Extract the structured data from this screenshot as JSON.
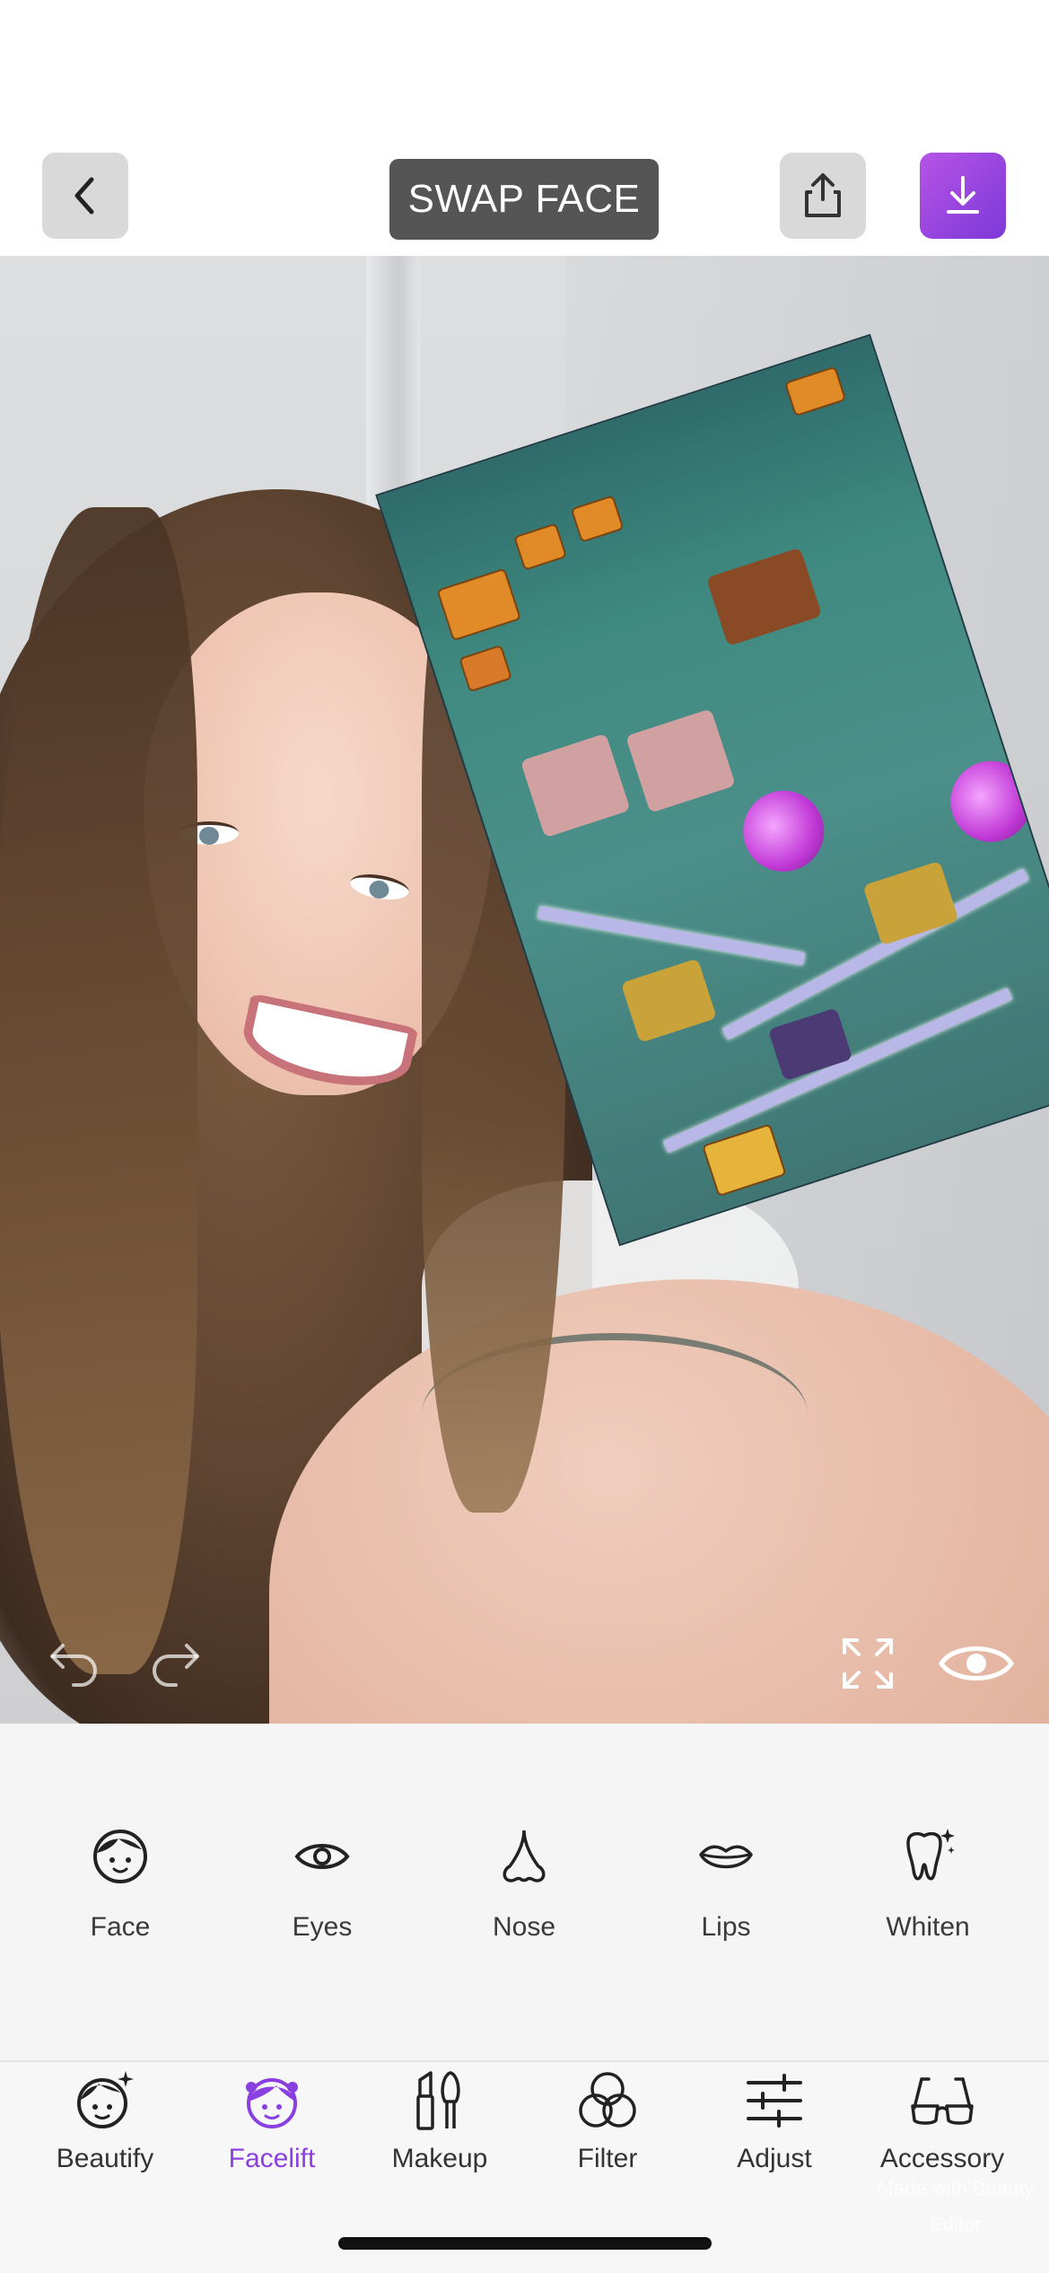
{
  "header": {
    "swap_face_label": "SWAP FACE",
    "back_icon": "chevron-left-icon",
    "share_icon": "share-icon",
    "download_icon": "download-icon",
    "accent": "#8e44de"
  },
  "canvas": {
    "controls": [
      "undo-icon",
      "redo-icon",
      "fullscreen-icon",
      "eye-icon"
    ]
  },
  "subtools": [
    {
      "label": "Face",
      "icon": "face-icon"
    },
    {
      "label": "Eyes",
      "icon": "eye-icon"
    },
    {
      "label": "Nose",
      "icon": "nose-icon"
    },
    {
      "label": "Lips",
      "icon": "lips-icon"
    },
    {
      "label": "Whiten",
      "icon": "tooth-sparkle-icon"
    }
  ],
  "bottom_nav": [
    {
      "label": "Beautify",
      "icon": "beautify-face-icon",
      "active": false
    },
    {
      "label": "Facelift",
      "icon": "facelift-girl-icon",
      "active": true
    },
    {
      "label": "Makeup",
      "icon": "makeup-brush-icon",
      "active": false
    },
    {
      "label": "Filter",
      "icon": "filter-circles-icon",
      "active": false
    },
    {
      "label": "Adjust",
      "icon": "sliders-icon",
      "active": false
    },
    {
      "label": "Accessory",
      "icon": "glasses-icon",
      "active": false
    }
  ],
  "watermark": "Made with Beauty Editor"
}
